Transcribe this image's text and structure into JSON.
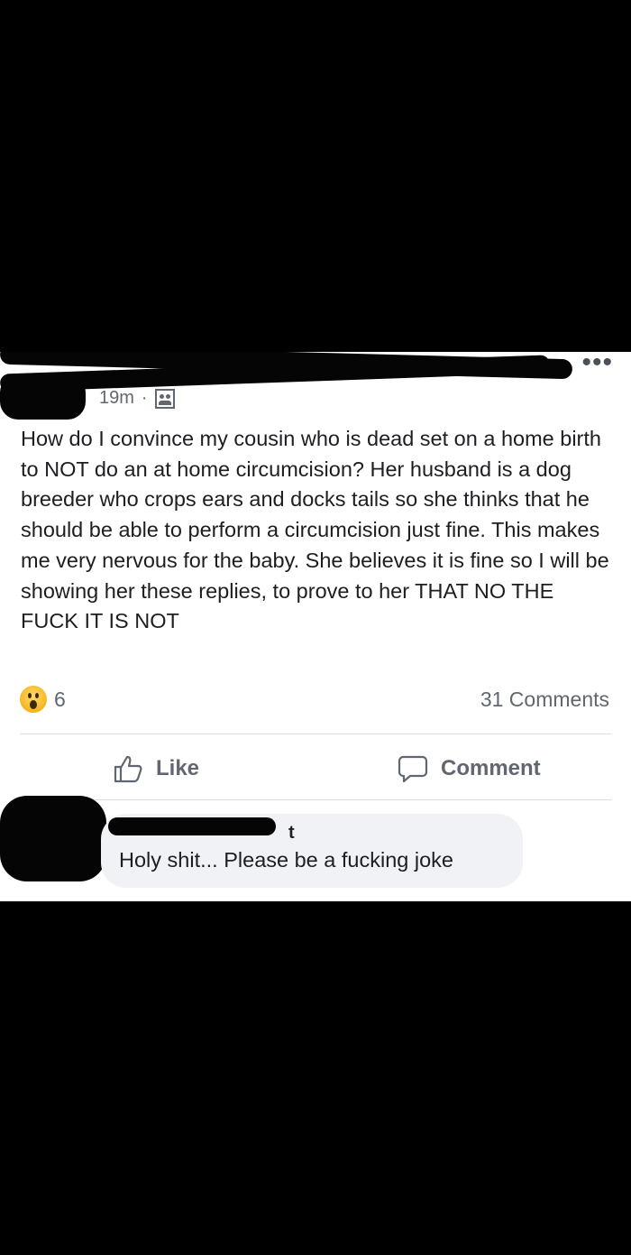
{
  "post": {
    "time": "19m",
    "separator": "·",
    "audience_icon": "friends-icon",
    "more_icon": "more-options-icon",
    "more_label": "•••",
    "text": "How do I convince my cousin who is dead set on a home birth to NOT do an at home circumcision? Her husband is a dog breeder who crops ears and docks tails so she thinks that he should be able to perform a circumcision just fine. This makes me very nervous for the baby. She believes it is fine so I will be showing her these replies, to prove to her THAT NO THE FUCK IT IS NOT"
  },
  "reactions": {
    "icon": "wow-reaction-icon",
    "count": "6",
    "comments_label": "31 Comments"
  },
  "actions": {
    "like_label": "Like",
    "comment_label": "Comment"
  },
  "comment": {
    "author_fragment": "t",
    "text": "Holy shit... Please be a fucking joke"
  },
  "colors": {
    "background": "#000000",
    "card": "#ffffff",
    "text": "#1c1e21",
    "muted": "#606770",
    "bubble": "#f0f2f5"
  }
}
